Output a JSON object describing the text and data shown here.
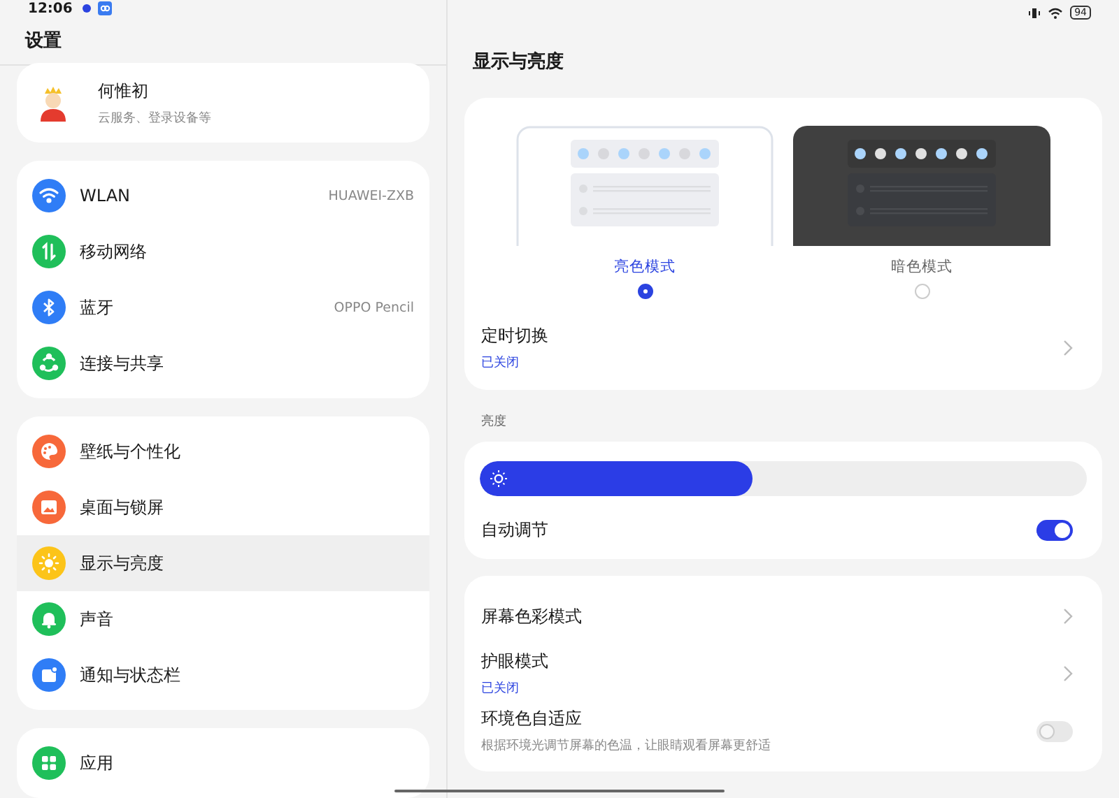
{
  "status_bar": {
    "time": "12:06",
    "battery": "94"
  },
  "sidebar": {
    "title": "设置",
    "profile": {
      "name": "何惟初",
      "subtitle": "云服务、登录设备等"
    },
    "groups": [
      {
        "items": [
          {
            "kind": "wifi",
            "label": "WLAN",
            "value": "HUAWEI-ZXB",
            "color": "#2f7df6",
            "selected": false
          },
          {
            "kind": "mobile",
            "label": "移动网络",
            "color": "#1fbf5a",
            "selected": false
          },
          {
            "kind": "bluetooth",
            "label": "蓝牙",
            "value": "OPPO Pencil",
            "color": "#2f7df6",
            "selected": false
          },
          {
            "kind": "share",
            "label": "连接与共享",
            "color": "#1fbf5a",
            "selected": false
          }
        ]
      },
      {
        "items": [
          {
            "kind": "palette",
            "label": "壁纸与个性化",
            "color": "#f7683a",
            "selected": false
          },
          {
            "kind": "image",
            "label": "桌面与锁屏",
            "color": "#f7683a",
            "selected": false
          },
          {
            "kind": "sun",
            "label": "显示与亮度",
            "color": "#fcc419",
            "selected": true
          },
          {
            "kind": "bell",
            "label": "声音",
            "color": "#1fbf5a",
            "selected": false
          },
          {
            "kind": "notification",
            "label": "通知与状态栏",
            "color": "#2f7df6",
            "selected": false
          }
        ]
      },
      {
        "items": [
          {
            "kind": "apps",
            "label": "应用",
            "color": "#1fbf5a",
            "selected": false
          }
        ]
      }
    ]
  },
  "detail": {
    "title": "显示与亮度",
    "modes": [
      {
        "kind": "light",
        "label": "亮色模式",
        "selected": true
      },
      {
        "kind": "dark",
        "label": "暗色模式",
        "selected": false
      }
    ],
    "schedule": {
      "label": "定时切换",
      "status": "已关闭"
    },
    "brightness": {
      "heading": "亮度",
      "level": 0.45,
      "auto": {
        "label": "自动调节",
        "on": true
      }
    },
    "options": [
      {
        "kind": "link",
        "label": "屏幕色彩模式"
      },
      {
        "kind": "link",
        "label": "护眼模式",
        "status": "已关闭"
      },
      {
        "kind": "switch",
        "label": "环境色自适应",
        "description": "根据环境光调节屏幕的色温，让眼睛观看屏幕更舒适",
        "on": false,
        "disabled": true
      }
    ]
  }
}
